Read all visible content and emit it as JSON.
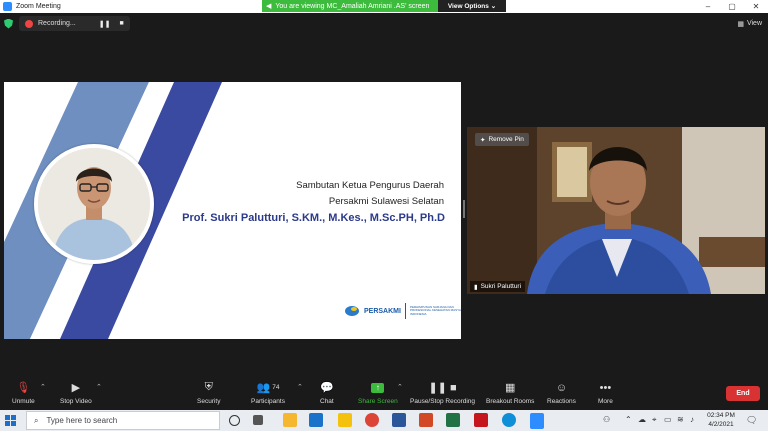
{
  "window": {
    "title": "Zoom Meeting"
  },
  "share_banner": {
    "text": "You are viewing MC_Amaliah Amriani .AS' screen",
    "options": "View Options"
  },
  "recording": {
    "label": "Recording..."
  },
  "view_button": {
    "label": "View"
  },
  "slide": {
    "line1": "Sambutan Ketua Pengurus Daerah",
    "line2": "Persakmi Sulawesi Selatan",
    "line3": "Prof. Sukri Palutturi, S.KM., M.Kes., M.Sc.PH, Ph.D",
    "logo_name": "PERSAKMI",
    "logo_tagline": "PERHIMPUNAN SARJANA DAN PROFESIONAL KESEHATAN MASYARAKAT INDONESIA"
  },
  "video": {
    "remove_pin": "Remove Pin",
    "participant_name": "Sukri Palutturi"
  },
  "toolbar": {
    "unmute": "Unmute",
    "stop_video": "Stop Video",
    "security": "Security",
    "participants": "Participants",
    "participant_count": "74",
    "chat": "Chat",
    "share_screen": "Share Screen",
    "record": "Pause/Stop Recording",
    "breakout": "Breakout Rooms",
    "reactions": "Reactions",
    "more": "More",
    "end": "End"
  },
  "taskbar": {
    "search_placeholder": "Type here to search",
    "time": "02:34 PM",
    "date": "4/2/2021"
  },
  "colors": {
    "slide_blue_light": "#6f8fc0",
    "slide_blue_dark": "#3a4aa0",
    "share_green": "#3dbb3d",
    "end_red": "#d83232"
  }
}
